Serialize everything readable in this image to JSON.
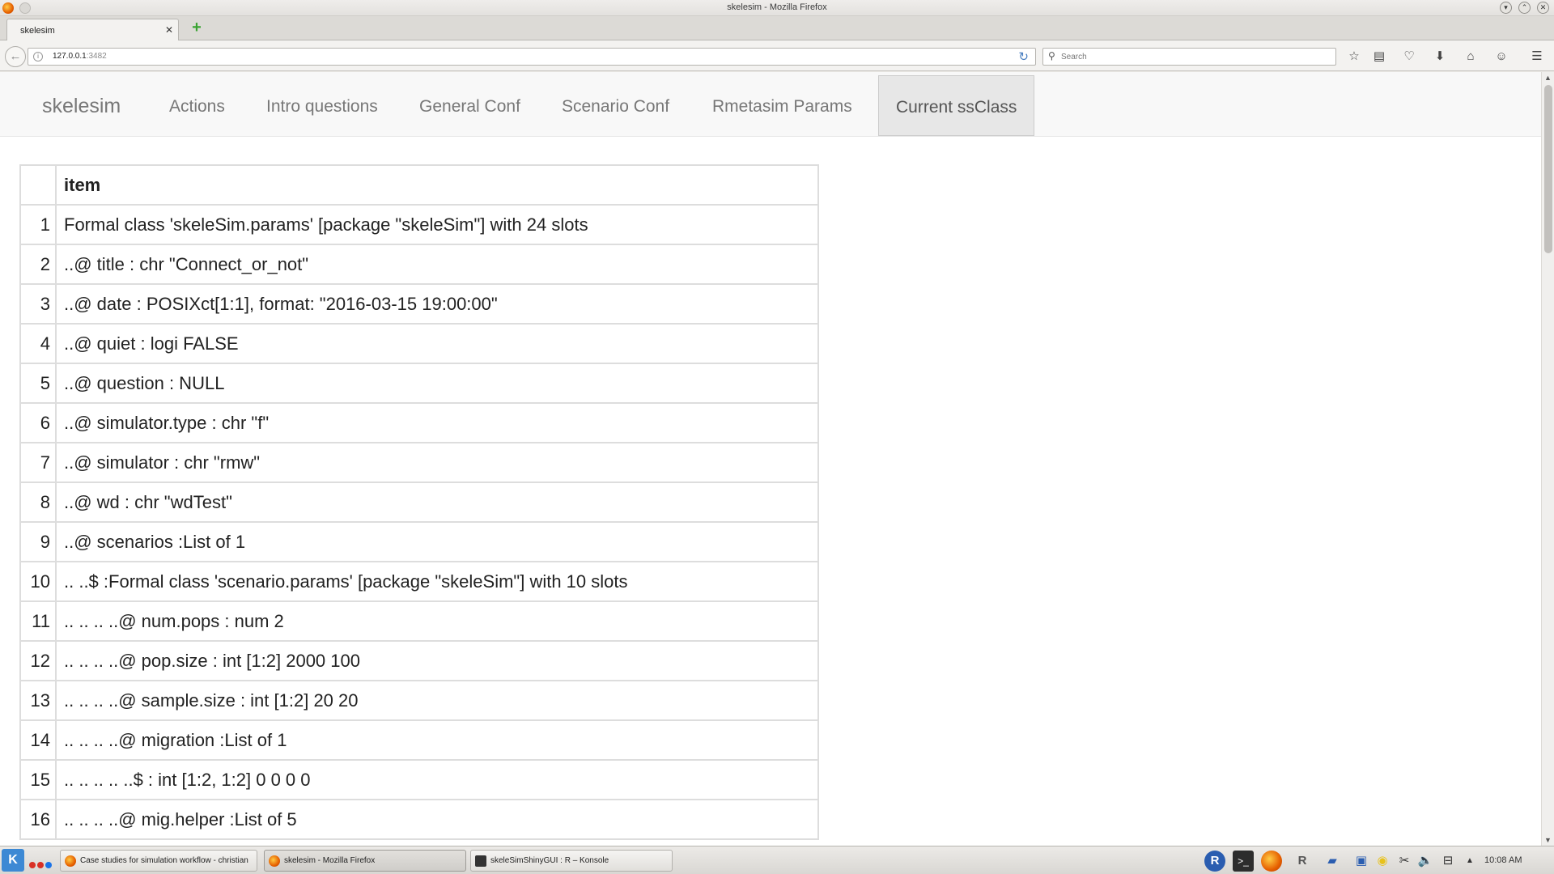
{
  "window": {
    "title": "skelesim - Mozilla Firefox",
    "controls": {
      "minimize": "▾",
      "maximize": "⌃",
      "close": "✕"
    }
  },
  "tab": {
    "label": "skelesim",
    "close": "✕",
    "new_tab": "+"
  },
  "nav": {
    "url_host": "127.0.0.1",
    "url_port": ":3482",
    "search_placeholder": "Search",
    "back": "←",
    "reload": "↻",
    "icons": [
      "star-icon",
      "reading-list-icon",
      "pocket-icon",
      "download-icon",
      "home-icon",
      "chat-icon",
      "menu-icon"
    ]
  },
  "app": {
    "brand": "skelesim",
    "menu": [
      "Actions",
      "Intro questions",
      "General Conf",
      "Scenario Conf",
      "Rmetasim Params",
      "Current ssClass"
    ],
    "active_menu": "Current ssClass"
  },
  "table": {
    "header": [
      "",
      "item"
    ],
    "rows": [
      [
        "1",
        "Formal class 'skeleSim.params' [package \"skeleSim\"] with 24 slots"
      ],
      [
        "2",
        "..@ title : chr \"Connect_or_not\""
      ],
      [
        "3",
        "..@ date : POSIXct[1:1], format: \"2016-03-15 19:00:00\""
      ],
      [
        "4",
        "..@ quiet : logi FALSE"
      ],
      [
        "5",
        "..@ question : NULL"
      ],
      [
        "6",
        "..@ simulator.type : chr \"f\""
      ],
      [
        "7",
        "..@ simulator : chr \"rmw\""
      ],
      [
        "8",
        "..@ wd : chr \"wdTest\""
      ],
      [
        "9",
        "..@ scenarios :List of 1"
      ],
      [
        "10",
        ".. ..$ :Formal class 'scenario.params' [package \"skeleSim\"] with 10 slots"
      ],
      [
        "11",
        ".. .. .. ..@ num.pops : num 2"
      ],
      [
        "12",
        ".. .. .. ..@ pop.size : int [1:2] 2000 100"
      ],
      [
        "13",
        ".. .. .. ..@ sample.size : int [1:2] 20 20"
      ],
      [
        "14",
        ".. .. .. ..@ migration :List of 1"
      ],
      [
        "15",
        ".. .. .. .. ..$ : int [1:2, 1:2] 0 0 0 0"
      ],
      [
        "16",
        ".. .. .. ..@ mig.helper :List of 5"
      ]
    ]
  },
  "taskbar": {
    "tasks": [
      "Case studies for simulation workflow - christian",
      "skelesim - Mozilla Firefox",
      "skeleSimShinyGUI : R – Konsole"
    ],
    "clock": "10:08 AM"
  }
}
